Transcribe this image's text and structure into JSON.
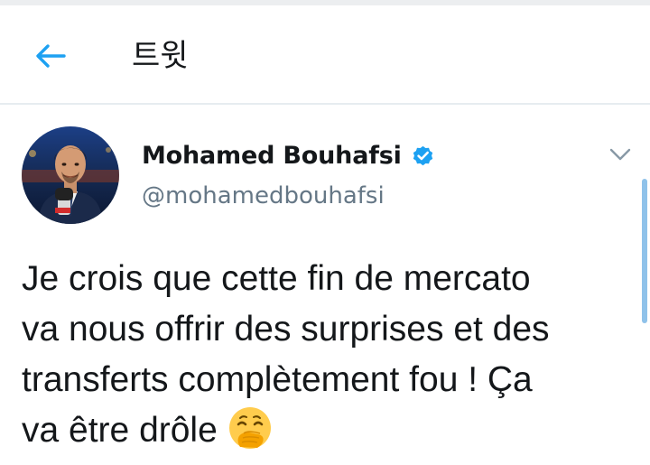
{
  "header": {
    "back_icon": "arrow-left-icon",
    "title": "트윗",
    "accent_color": "#1da1f2"
  },
  "tweet": {
    "author": {
      "display_name": "Mohamed Bouhafsi",
      "handle": "@mohamedbouhafsi",
      "verified": true,
      "verified_icon": "verified-badge-icon"
    },
    "menu_icon": "chevron-down-icon",
    "text": "Je crois que cette fin de mercato\nva nous offrir des surprises et des\ntransferts complètement fou ! Ça\nva être drôle ",
    "emoji": "face-with-hand-over-mouth-icon"
  }
}
